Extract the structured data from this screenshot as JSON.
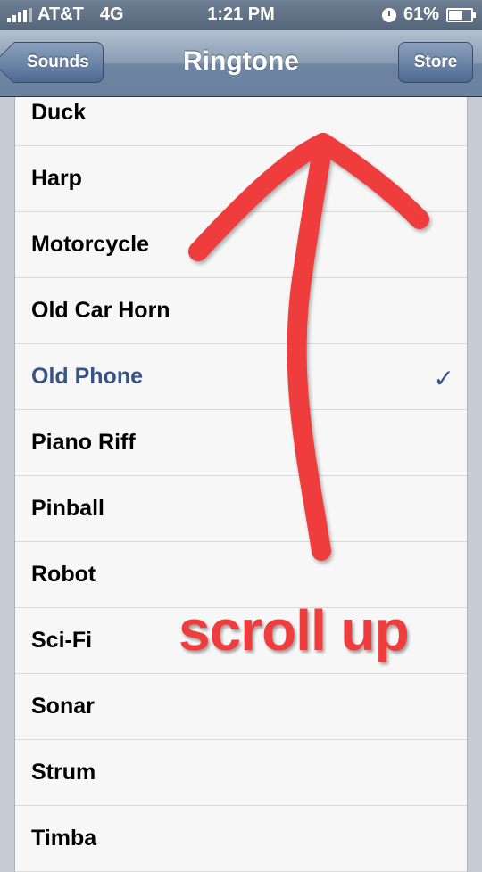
{
  "status_bar": {
    "carrier": "AT&T",
    "network": "4G",
    "time": "1:21 PM",
    "battery": "61%",
    "battery_level": 0.61
  },
  "nav": {
    "back_label": "Sounds",
    "title": "Ringtone",
    "store_label": "Store"
  },
  "ringtones": [
    {
      "label": "Duck",
      "selected": false
    },
    {
      "label": "Harp",
      "selected": false
    },
    {
      "label": "Motorcycle",
      "selected": false
    },
    {
      "label": "Old Car Horn",
      "selected": false
    },
    {
      "label": "Old Phone",
      "selected": true
    },
    {
      "label": "Piano Riff",
      "selected": false
    },
    {
      "label": "Pinball",
      "selected": false
    },
    {
      "label": "Robot",
      "selected": false
    },
    {
      "label": "Sci-Fi",
      "selected": false
    },
    {
      "label": "Sonar",
      "selected": false
    },
    {
      "label": "Strum",
      "selected": false
    },
    {
      "label": "Timba",
      "selected": false
    }
  ],
  "check_mark": "✓",
  "annotation": {
    "text": "scroll up",
    "color": "#ef3d3d",
    "direction": "up"
  },
  "colors": {
    "selected_text": "#385487",
    "nav_bar": "#6d84a2"
  }
}
